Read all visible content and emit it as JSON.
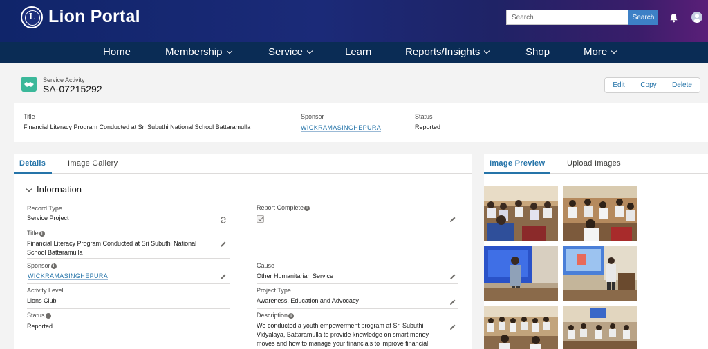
{
  "app": {
    "brand": "Lion Portal",
    "search": {
      "placeholder": "Search",
      "button": "Search"
    }
  },
  "nav": {
    "home": "Home",
    "membership": "Membership",
    "service": "Service",
    "learn": "Learn",
    "reports": "Reports/Insights",
    "shop": "Shop",
    "more": "More"
  },
  "record": {
    "type_label": "Service Activity",
    "name": "SA-07215292",
    "actions": {
      "edit": "Edit",
      "copy": "Copy",
      "delete": "Delete"
    }
  },
  "highlights": {
    "title_label": "Title",
    "title_value": "Financial Literacy Program Conducted at Sri Subuthi National School Battaramulla",
    "sponsor_label": "Sponsor",
    "sponsor_value": "WICKRAMASINGHEPURA",
    "status_label": "Status",
    "status_value": "Reported"
  },
  "tabs": {
    "details": "Details",
    "gallery": "Image Gallery"
  },
  "section": {
    "title": "Information"
  },
  "fields": {
    "record_type_label": "Record Type",
    "record_type_value": "Service Project",
    "report_complete_label": "Report Complete",
    "report_complete_value": true,
    "title_label": "Title",
    "title_value": "Financial Literacy Program Conducted at Sri Subuthi National School Battaramulla",
    "sponsor_label": "Sponsor",
    "sponsor_value": "WICKRAMASINGHEPURA",
    "cause_label": "Cause",
    "cause_value": "Other Humanitarian Service",
    "activity_level_label": "Activity Level",
    "activity_level_value": "Lions Club",
    "project_type_label": "Project Type",
    "project_type_value": "Awareness, Education and Advocacy",
    "status_label": "Status",
    "status_value": "Reported",
    "description_label": "Description",
    "description_value": "We conducted a youth empowerment program at Sri Subuthi Vidyalaya, Battaramulla to provide knowledge on smart money moves and how to manage your financials to improve financial"
  },
  "side": {
    "preview_tab": "Image Preview",
    "upload_tab": "Upload Images"
  },
  "colors": {
    "brand_blue": "#2574a9",
    "nav_bg": "#0a2c55",
    "search_button": "#3d80c6",
    "record_icon": "#3bb89a"
  }
}
